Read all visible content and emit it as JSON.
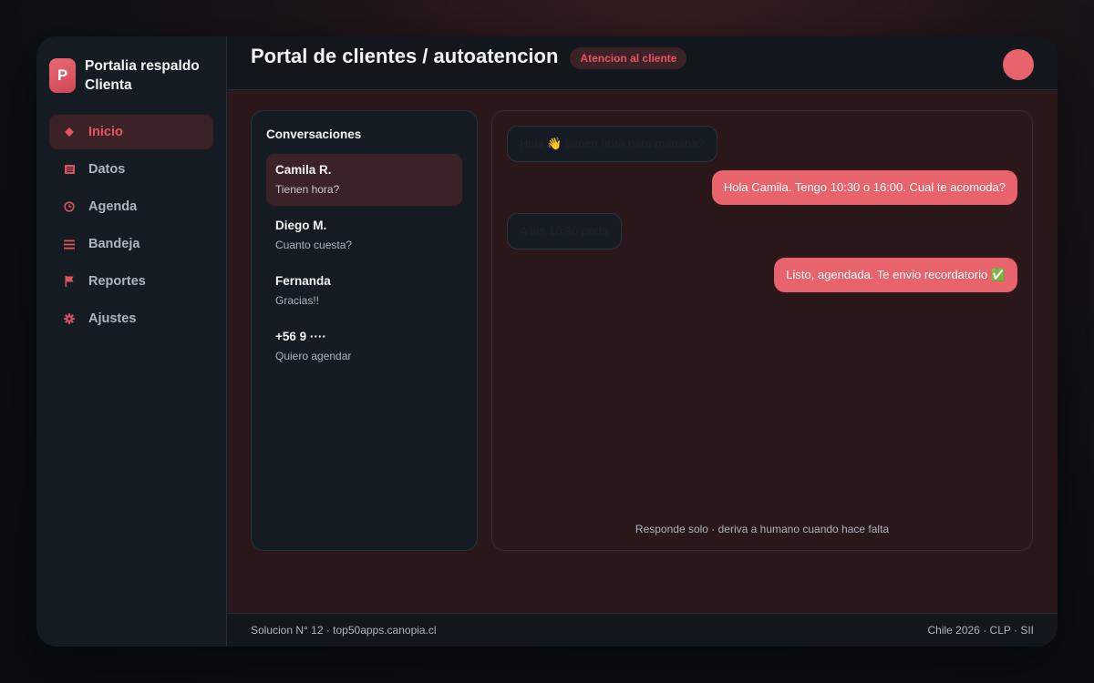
{
  "brand": {
    "logo_letter": "P",
    "name": "Portalia respaldo Clienta"
  },
  "sidebar": {
    "items": [
      {
        "label": "Inicio",
        "icon": "diamond-icon",
        "active": true
      },
      {
        "label": "Datos",
        "icon": "table-icon",
        "active": false
      },
      {
        "label": "Agenda",
        "icon": "clock-icon",
        "active": false
      },
      {
        "label": "Bandeja",
        "icon": "list-icon",
        "active": false
      },
      {
        "label": "Reportes",
        "icon": "flag-icon",
        "active": false
      },
      {
        "label": "Ajustes",
        "icon": "gear-icon",
        "active": false
      }
    ]
  },
  "header": {
    "title": "Portal de clientes / autoatencion",
    "badge": "Atencion al cliente"
  },
  "conversations": {
    "title": "Conversaciones",
    "items": [
      {
        "name": "Camila R.",
        "preview": "Tienen hora?"
      },
      {
        "name": "Diego M.",
        "preview": "Cuanto cuesta?"
      },
      {
        "name": "Fernanda",
        "preview": "Gracias!!"
      },
      {
        "name": "+56 9 ····",
        "preview": "Quiero agendar"
      }
    ]
  },
  "chat": {
    "messages": [
      {
        "direction": "in",
        "text": "Hola 👋 tienen hora para manana?"
      },
      {
        "direction": "out",
        "text": "Hola Camila. Tengo 10:30 o 16:00. Cual te acomoda?"
      },
      {
        "direction": "in",
        "text": "A las 10:30 porfa"
      },
      {
        "direction": "out",
        "text": "Listo, agendada. Te envio recordatorio ✅"
      }
    ],
    "footer_note": "Responde solo · deriva a humano cuando hace falta"
  },
  "footer": {
    "left": "Solucion N° 12 · top50apps.canopia.cl",
    "right": "Chile 2026 · CLP · SII"
  },
  "colors": {
    "accent": "#e8636c",
    "accent_text": "#e8545f",
    "active_bg": "#3a2226",
    "panel_bg": "#151b22",
    "main_bg": "#2a1719"
  }
}
